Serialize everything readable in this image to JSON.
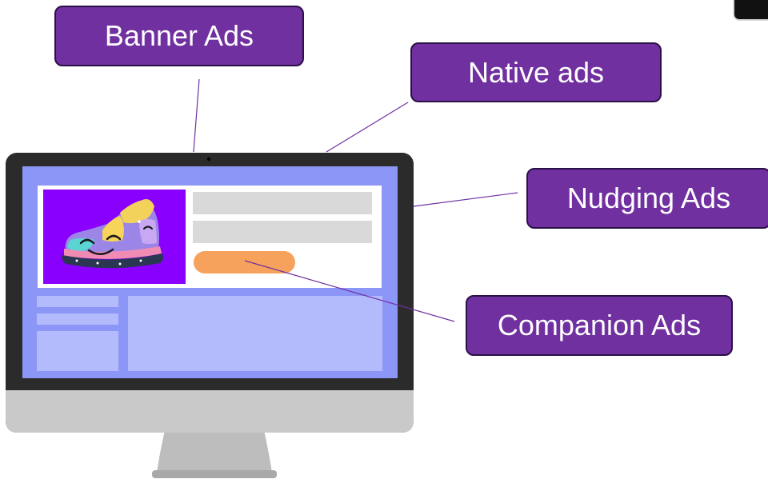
{
  "labels": {
    "banner": "Banner Ads",
    "native": "Native ads",
    "nudging": "Nudging Ads",
    "companion": "Companion Ads"
  },
  "colors": {
    "label_fill": "#7030a0",
    "label_border": "#2b1147",
    "screen_frame": "#8c96f6",
    "content_area": "#b3bbfd",
    "ad_image_bg": "#8a00fe",
    "placeholder_bar": "#d9d9d9",
    "cta_button": "#f6a25c",
    "monitor_bezel": "#2b2b2b",
    "monitor_chin": "#c7c7c7"
  },
  "icons": {
    "ad_image": "sneaker-illustration-icon",
    "camera": "webcam-dot-icon"
  }
}
